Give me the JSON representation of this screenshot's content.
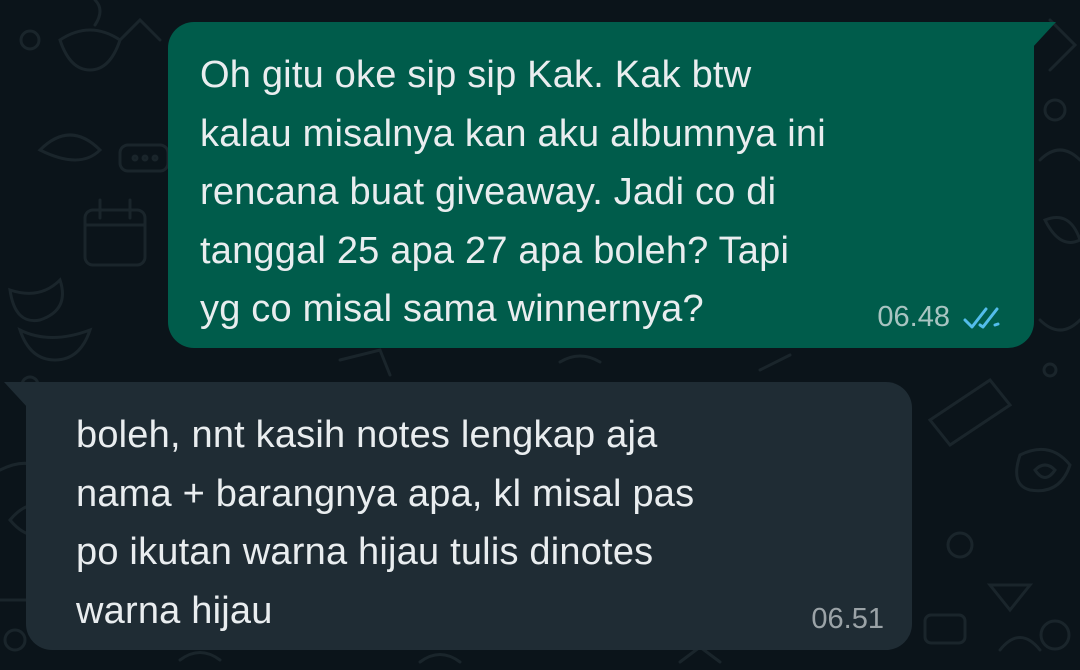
{
  "messages": {
    "outgoing": {
      "text": "Oh gitu oke sip sip Kak. Kak btw\nkalau misalnya kan aku albumnya ini\nrencana buat giveaway. Jadi co di\ntanggal 25 apa 27 apa boleh? Tapi\nyg co misal sama winnernya?",
      "time": "06.48",
      "status_icon": "double-check-read-icon"
    },
    "incoming": {
      "text": "boleh, nnt kasih notes lengkap aja\nnama + barangnya apa, kl misal pas\npo ikutan warna hijau tulis dinotes\nwarna hijau",
      "time": "06.51"
    }
  },
  "colors": {
    "background": "#0b141a",
    "outgoing_bubble": "#005c4b",
    "incoming_bubble": "#1f2c34",
    "read_ticks": "#53bdeb",
    "text": "#e9edef"
  }
}
